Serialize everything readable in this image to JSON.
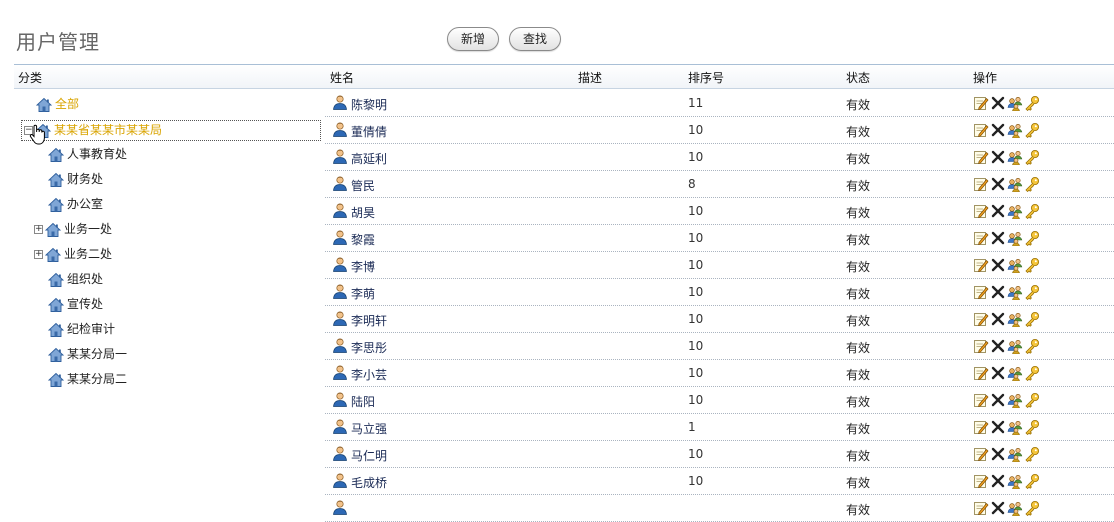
{
  "page": {
    "title": "用户管理"
  },
  "toolbar": {
    "add_label": "新增",
    "find_label": "查找"
  },
  "columns": {
    "category": "分类",
    "name": "姓名",
    "desc": "描述",
    "order": "排序号",
    "status": "状态",
    "ops": "操作"
  },
  "tree": {
    "items": [
      {
        "label": "全部",
        "level": 0,
        "expander": "",
        "active": true
      },
      {
        "label": "某某省某某市某某局",
        "level": 0,
        "expander": "−",
        "active": true,
        "selected": true
      },
      {
        "label": "人事教育处",
        "level": 2,
        "expander": ""
      },
      {
        "label": "财务处",
        "level": 2,
        "expander": ""
      },
      {
        "label": "办公室",
        "level": 2,
        "expander": ""
      },
      {
        "label": "业务一处",
        "level": 1,
        "expander": "+"
      },
      {
        "label": "业务二处",
        "level": 1,
        "expander": "+"
      },
      {
        "label": "组织处",
        "level": 2,
        "expander": ""
      },
      {
        "label": "宣传处",
        "level": 2,
        "expander": ""
      },
      {
        "label": "纪检审计",
        "level": 2,
        "expander": ""
      },
      {
        "label": "某某分局一",
        "level": 2,
        "expander": ""
      },
      {
        "label": "某某分局二",
        "level": 2,
        "expander": ""
      }
    ]
  },
  "users": [
    {
      "name": "陈黎明",
      "desc": "",
      "order": "11",
      "status": "有效"
    },
    {
      "name": "董倩倩",
      "desc": "",
      "order": "10",
      "status": "有效"
    },
    {
      "name": "高延利",
      "desc": "",
      "order": "10",
      "status": "有效"
    },
    {
      "name": "管民",
      "desc": "",
      "order": "8",
      "status": "有效"
    },
    {
      "name": "胡昊",
      "desc": "",
      "order": "10",
      "status": "有效"
    },
    {
      "name": "黎霞",
      "desc": "",
      "order": "10",
      "status": "有效"
    },
    {
      "name": "李博",
      "desc": "",
      "order": "10",
      "status": "有效"
    },
    {
      "name": "李萌",
      "desc": "",
      "order": "10",
      "status": "有效"
    },
    {
      "name": "李明轩",
      "desc": "",
      "order": "10",
      "status": "有效"
    },
    {
      "name": "李思彤",
      "desc": "",
      "order": "10",
      "status": "有效"
    },
    {
      "name": "李小芸",
      "desc": "",
      "order": "10",
      "status": "有效"
    },
    {
      "name": "陆阳",
      "desc": "",
      "order": "10",
      "status": "有效"
    },
    {
      "name": "马立强",
      "desc": "",
      "order": "1",
      "status": "有效"
    },
    {
      "name": "马仁明",
      "desc": "",
      "order": "10",
      "status": "有效"
    },
    {
      "name": "毛成桥",
      "desc": "",
      "order": "10",
      "status": "有效"
    },
    {
      "name": "",
      "desc": "",
      "order": "",
      "status": "有效"
    }
  ],
  "row_actions": [
    "edit-icon",
    "delete-icon",
    "roles-icon",
    "password-key-icon"
  ],
  "icons": {
    "tree_node": "house-icon",
    "user": "user-icon",
    "cursor": "hand-cursor-icon"
  },
  "colors": {
    "accent_active": "#d9a400",
    "header_border": "#a9bfd6",
    "link_name": "#1a2a55"
  }
}
